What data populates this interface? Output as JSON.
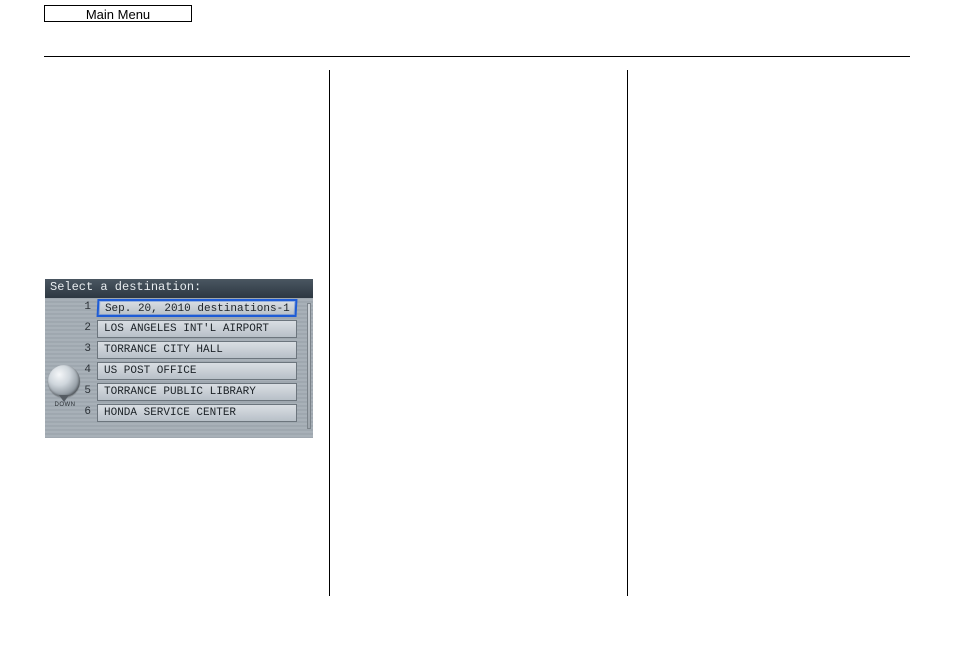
{
  "header": {
    "main_menu_label": "Main Menu"
  },
  "nav_screen": {
    "title": "Select a destination:",
    "down_label": "DOWN",
    "items": [
      {
        "index": "1",
        "label": "Sep. 20, 2010 destinations-1",
        "selected": true
      },
      {
        "index": "2",
        "label": "LOS ANGELES INT'L AIRPORT",
        "selected": false
      },
      {
        "index": "3",
        "label": "TORRANCE CITY HALL",
        "selected": false
      },
      {
        "index": "4",
        "label": "US POST OFFICE",
        "selected": false
      },
      {
        "index": "5",
        "label": "TORRANCE PUBLIC LIBRARY",
        "selected": false
      },
      {
        "index": "6",
        "label": "HONDA SERVICE CENTER",
        "selected": false
      }
    ]
  }
}
